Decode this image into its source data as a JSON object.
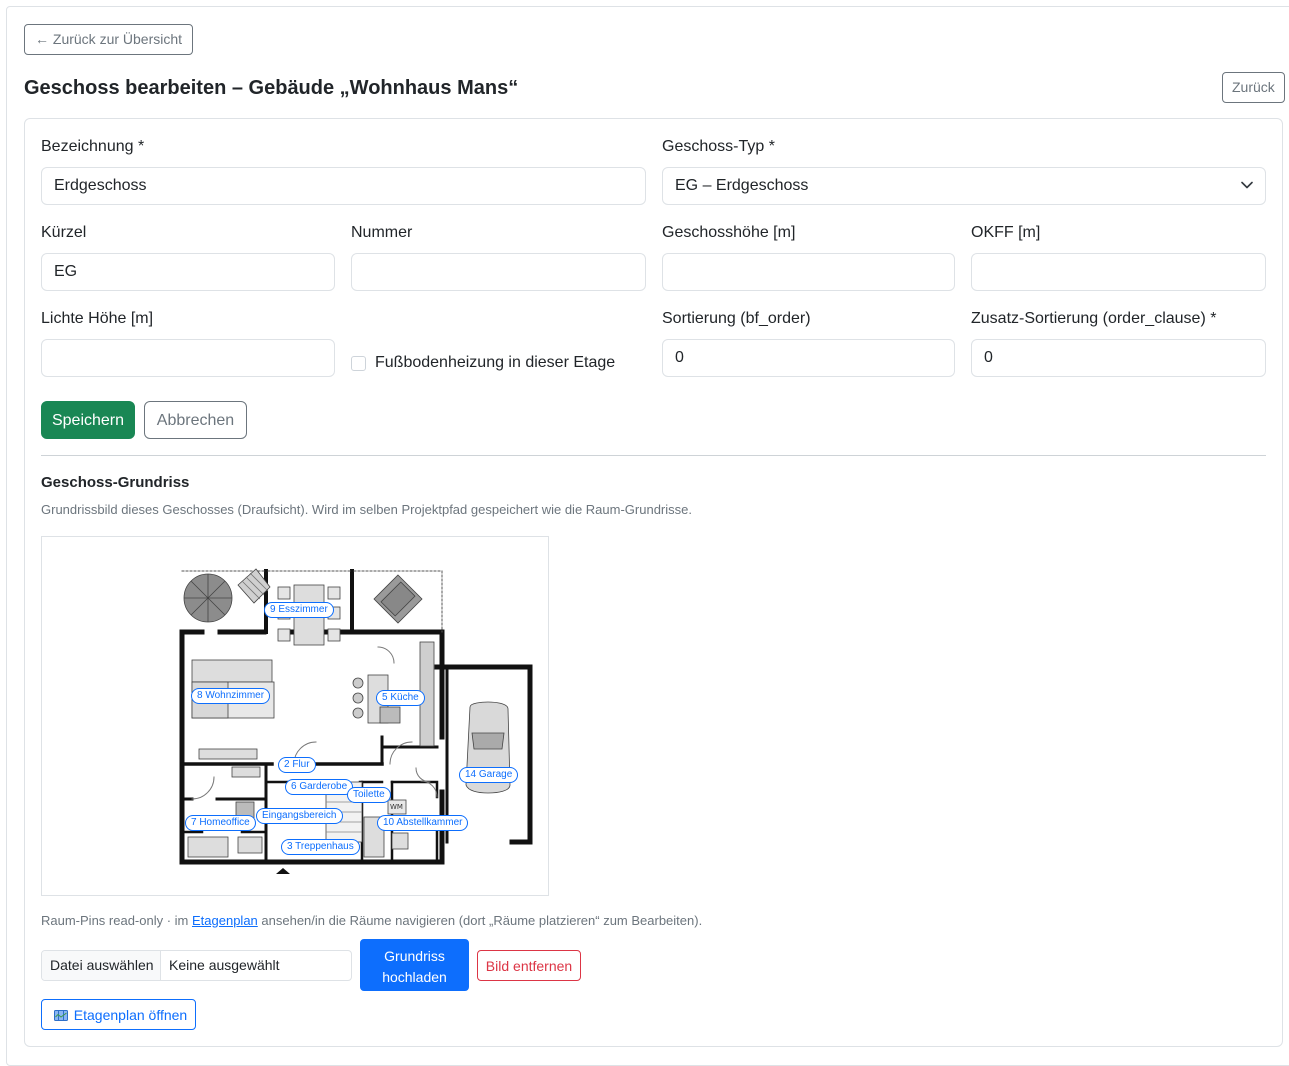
{
  "nav": {
    "back_label": "← Zurück zur Übersicht",
    "back_right_label": "Zurück"
  },
  "page": {
    "title": "Geschoss bearbeiten – Gebäude „Wohnhaus Mans“"
  },
  "form": {
    "bezeichnung": {
      "label": "Bezeichnung *",
      "value": "Erdgeschoss"
    },
    "geschoss_typ": {
      "label": "Geschoss-Typ *",
      "value": "EG – Erdgeschoss"
    },
    "kuerzel": {
      "label": "Kürzel",
      "value": "EG"
    },
    "nummer": {
      "label": "Nummer",
      "value": ""
    },
    "geschosshoehe": {
      "label": "Geschosshöhe [m]",
      "value": ""
    },
    "okff": {
      "label": "OKFF [m]",
      "value": ""
    },
    "lichte_hoehe": {
      "label": "Lichte Höhe [m]",
      "value": ""
    },
    "fussbodenheizung": {
      "label": "Fußbodenheizung in dieser Etage",
      "checked": false
    },
    "sortierung": {
      "label": "Sortierung (bf_order)",
      "value": "0"
    },
    "zusatz_sortierung": {
      "label": "Zusatz-Sortierung (order_clause) *",
      "value": "0"
    },
    "save_label": "Speichern",
    "cancel_label": "Abbrechen"
  },
  "grundriss": {
    "title": "Geschoss-Grundriss",
    "description": "Grundrissbild dieses Geschosses (Draufsicht). Wird im selben Projektpfad gespeichert wie die Raum-Grundrisse.",
    "pins": [
      "9 Esszimmer",
      "8 Wohnzimmer",
      "5 Küche",
      "14 Garage",
      "2 Flur",
      "6 Garderobe",
      "Toilette",
      "7 Homeoffice",
      "Eingangsbereich",
      "10 Abstellkammer",
      "3 Treppenhaus"
    ],
    "wm_label": "WM",
    "note_before": "Raum-Pins read-only · im ",
    "note_link": "Etagenplan",
    "note_after": " ansehen/in die Räume navigieren (dort „Räume platzieren“ zum Bearbeiten).",
    "file_choose_label": "Datei auswählen",
    "file_none_label": "Keine ausgewählt",
    "upload_label_1": "Grundriss",
    "upload_label_2": "hochladen",
    "remove_label": "Bild entfernen",
    "open_plan_label": "Etagenplan öffnen"
  },
  "colors": {
    "primary": "#0d6efd",
    "success": "#198754",
    "danger": "#dc3545",
    "secondary": "#6c757d"
  }
}
